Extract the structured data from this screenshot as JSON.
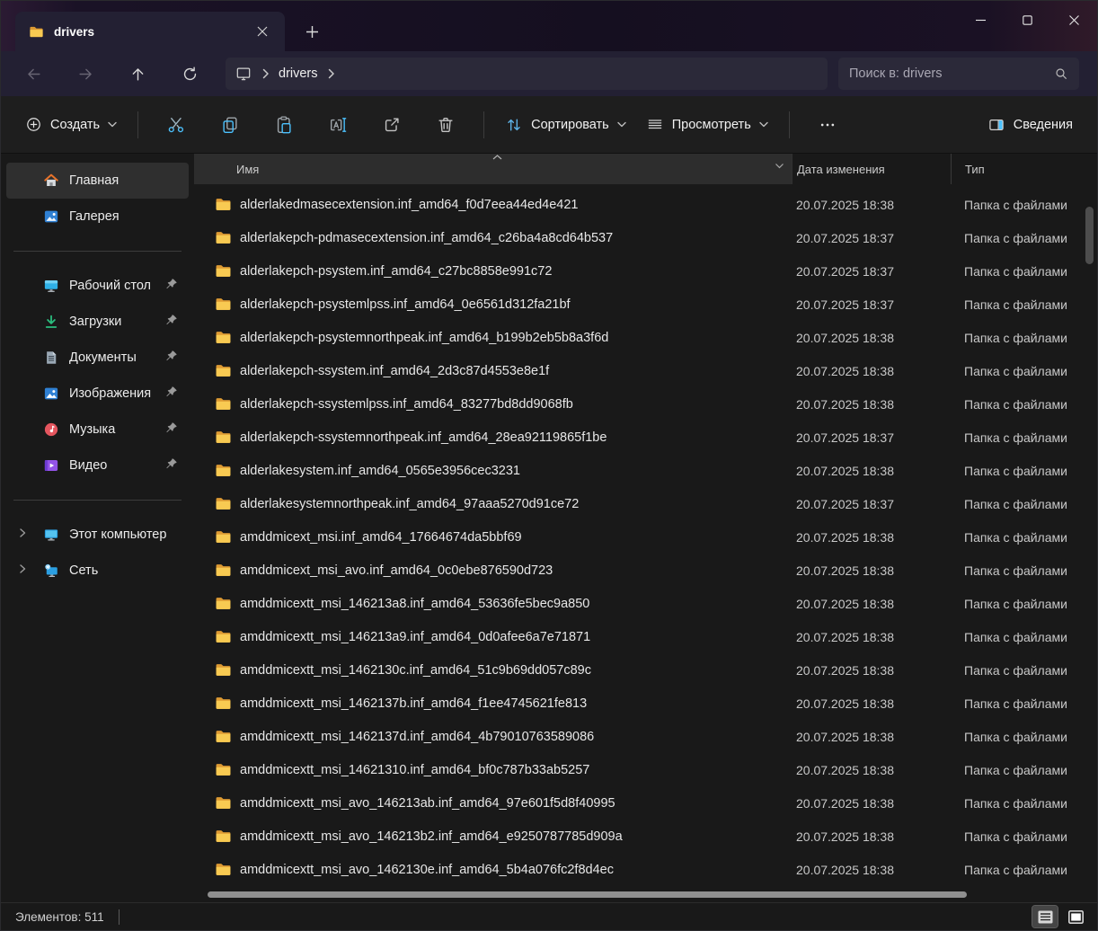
{
  "window": {
    "tab_title": "drivers",
    "controls": {
      "minimize": "minimize",
      "maximize": "maximize",
      "close": "close"
    }
  },
  "navigation": {
    "breadcrumb_root": "this-pc",
    "breadcrumb": "drivers",
    "search_placeholder": "Поиск в: drivers"
  },
  "toolbar": {
    "create_label": "Создать",
    "sort_label": "Сортировать",
    "view_label": "Просмотреть",
    "details_label": "Сведения"
  },
  "sidebar": {
    "items": [
      {
        "label": "Главная",
        "icon": "home",
        "selected": true
      },
      {
        "label": "Галерея",
        "icon": "gallery"
      },
      {
        "divider": true
      },
      {
        "label": "Рабочий стол",
        "icon": "desktop",
        "pinned": true
      },
      {
        "label": "Загрузки",
        "icon": "downloads",
        "pinned": true
      },
      {
        "label": "Документы",
        "icon": "documents",
        "pinned": true
      },
      {
        "label": "Изображения",
        "icon": "pictures",
        "pinned": true
      },
      {
        "label": "Музыка",
        "icon": "music",
        "pinned": true
      },
      {
        "label": "Видео",
        "icon": "video",
        "pinned": true
      },
      {
        "divider": true
      },
      {
        "label": "Этот компьютер",
        "icon": "computer",
        "expandable": true
      },
      {
        "label": "Сеть",
        "icon": "network",
        "expandable": true
      }
    ]
  },
  "table": {
    "headers": {
      "name": "Имя",
      "date": "Дата изменения",
      "type": "Тип"
    },
    "rows": [
      {
        "name": "alderlakedmasecextension.inf_amd64_f0d7eea44ed4e421",
        "date": "20.07.2025 18:38",
        "type": "Папка с файлами"
      },
      {
        "name": "alderlakepch-pdmasecextension.inf_amd64_c26ba4a8cd64b537",
        "date": "20.07.2025 18:37",
        "type": "Папка с файлами"
      },
      {
        "name": "alderlakepch-psystem.inf_amd64_c27bc8858e991c72",
        "date": "20.07.2025 18:37",
        "type": "Папка с файлами"
      },
      {
        "name": "alderlakepch-psystemlpss.inf_amd64_0e6561d312fa21bf",
        "date": "20.07.2025 18:37",
        "type": "Папка с файлами"
      },
      {
        "name": "alderlakepch-psystemnorthpeak.inf_amd64_b199b2eb5b8a3f6d",
        "date": "20.07.2025 18:38",
        "type": "Папка с файлами"
      },
      {
        "name": "alderlakepch-ssystem.inf_amd64_2d3c87d4553e8e1f",
        "date": "20.07.2025 18:38",
        "type": "Папка с файлами"
      },
      {
        "name": "alderlakepch-ssystemlpss.inf_amd64_83277bd8dd9068fb",
        "date": "20.07.2025 18:38",
        "type": "Папка с файлами"
      },
      {
        "name": "alderlakepch-ssystemnorthpeak.inf_amd64_28ea92119865f1be",
        "date": "20.07.2025 18:37",
        "type": "Папка с файлами"
      },
      {
        "name": "alderlakesystem.inf_amd64_0565e3956cec3231",
        "date": "20.07.2025 18:38",
        "type": "Папка с файлами"
      },
      {
        "name": "alderlakesystemnorthpeak.inf_amd64_97aaa5270d91ce72",
        "date": "20.07.2025 18:37",
        "type": "Папка с файлами"
      },
      {
        "name": "amddmicext_msi.inf_amd64_17664674da5bbf69",
        "date": "20.07.2025 18:38",
        "type": "Папка с файлами"
      },
      {
        "name": "amddmicext_msi_avo.inf_amd64_0c0ebe876590d723",
        "date": "20.07.2025 18:38",
        "type": "Папка с файлами"
      },
      {
        "name": "amddmicextt_msi_146213a8.inf_amd64_53636fe5bec9a850",
        "date": "20.07.2025 18:38",
        "type": "Папка с файлами"
      },
      {
        "name": "amddmicextt_msi_146213a9.inf_amd64_0d0afee6a7e71871",
        "date": "20.07.2025 18:38",
        "type": "Папка с файлами"
      },
      {
        "name": "amddmicextt_msi_1462130c.inf_amd64_51c9b69dd057c89c",
        "date": "20.07.2025 18:38",
        "type": "Папка с файлами"
      },
      {
        "name": "amddmicextt_msi_1462137b.inf_amd64_f1ee4745621fe813",
        "date": "20.07.2025 18:38",
        "type": "Папка с файлами"
      },
      {
        "name": "amddmicextt_msi_1462137d.inf_amd64_4b79010763589086",
        "date": "20.07.2025 18:38",
        "type": "Папка с файлами"
      },
      {
        "name": "amddmicextt_msi_14621310.inf_amd64_bf0c787b33ab5257",
        "date": "20.07.2025 18:38",
        "type": "Папка с файлами"
      },
      {
        "name": "amddmicextt_msi_avo_146213ab.inf_amd64_97e601f5d8f40995",
        "date": "20.07.2025 18:38",
        "type": "Папка с файлами"
      },
      {
        "name": "amddmicextt_msi_avo_146213b2.inf_amd64_e9250787785d909a",
        "date": "20.07.2025 18:38",
        "type": "Папка с файлами"
      },
      {
        "name": "amddmicextt_msi_avo_1462130e.inf_amd64_5b4a076fc2f8d4ec",
        "date": "20.07.2025 18:38",
        "type": "Папка с файлами"
      }
    ]
  },
  "statusbar": {
    "items_count": "Элементов: 511"
  },
  "colors": {
    "accent_blue": "#4cc2ff",
    "folder_yellow": "#f8ca52",
    "selected_bg": "#2f2f2f"
  }
}
